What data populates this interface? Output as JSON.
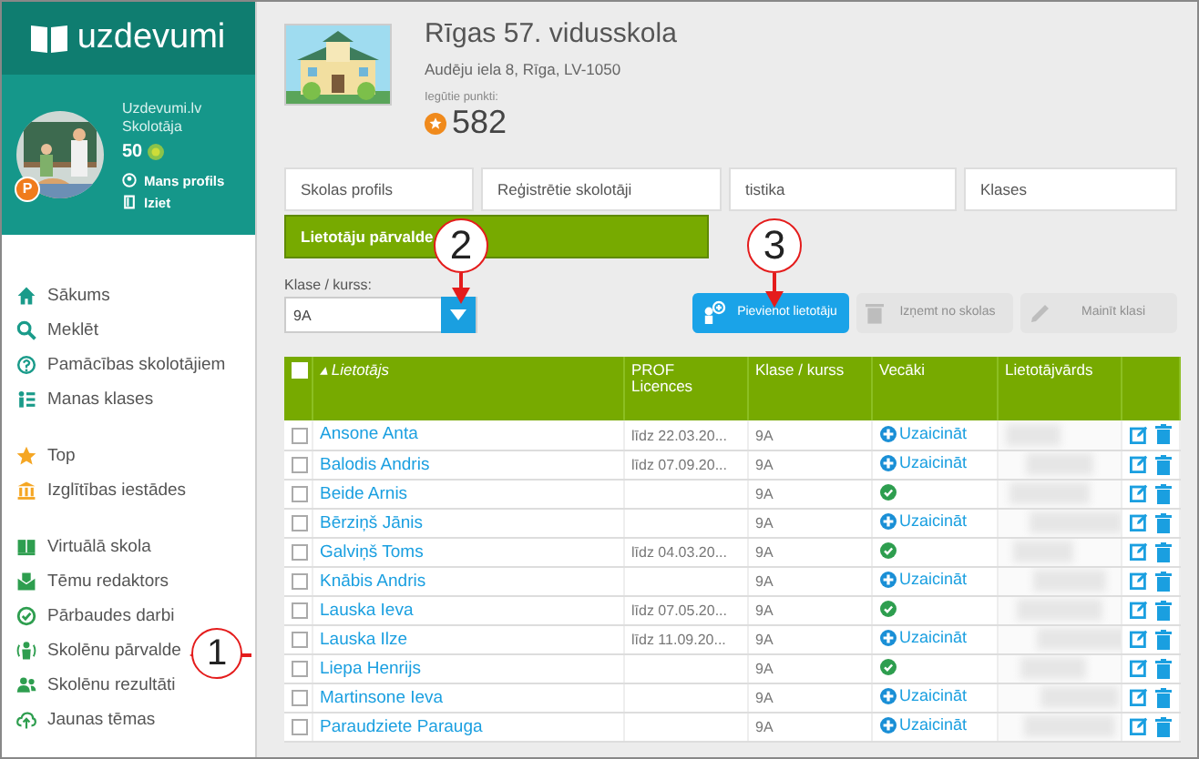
{
  "sidebar": {
    "logo": "uzdevumi",
    "profile": {
      "name": "Uzdevumi.lv",
      "role": "Skolotāja",
      "badge": "P",
      "points": "50",
      "links": [
        "Mans profils",
        "Iziet"
      ]
    },
    "nav_groups": [
      {
        "items": [
          {
            "label": "Sākums"
          },
          {
            "label": "Meklēt"
          },
          {
            "label": "Pamācības skolotājiem"
          },
          {
            "label": "Manas klases"
          }
        ]
      },
      {
        "items": [
          {
            "label": "Top"
          },
          {
            "label": "Izglītības iestādes"
          }
        ]
      },
      {
        "items": [
          {
            "label": "Virtuālā skola"
          },
          {
            "label": "Tēmu redaktors"
          },
          {
            "label": "Pārbaudes darbi"
          },
          {
            "label": "Skolēnu pārvalde"
          },
          {
            "label": "Skolēnu rezultāti"
          },
          {
            "label": "Jaunas tēmas"
          }
        ]
      }
    ]
  },
  "school": {
    "name": "Rīgas 57. vidusskola",
    "address": "Audēju iela 8, Rīga, LV-1050",
    "points_label": "Iegūtie punkti:",
    "points": "582"
  },
  "tabs": [
    {
      "label": "Skolas profils",
      "selected": false
    },
    {
      "label": "Reģistrētie skolotāji",
      "selected": false
    },
    {
      "label": "tistika",
      "selected": false
    },
    {
      "label": "Klases",
      "selected": false
    },
    {
      "label": "Lietotāju pārvalde",
      "selected": true
    }
  ],
  "filter": {
    "label": "Klase / kurss:",
    "value": "9A"
  },
  "buttons": [
    {
      "label": "Pievienot lietotāju",
      "disabled": false
    },
    {
      "label": "Izņemt no skolas",
      "disabled": true
    },
    {
      "label": "Mainīt klasi",
      "disabled": true
    }
  ],
  "table": {
    "select_all": false,
    "sort_mark": "▴",
    "columns": [
      "Lietotājs",
      "PROF Licences",
      "Klase / kurss",
      "Vecāki",
      "Lietotājvārds"
    ],
    "rows": [
      {
        "checked": false,
        "name": "Ansone Anta",
        "licence": "līdz 22.03.20...",
        "class": "9A",
        "parents": {
          "kind": "invite",
          "label": "Uzaicināt"
        }
      },
      {
        "checked": false,
        "name": "Balodis Andris",
        "licence": "līdz 07.09.20...",
        "class": "9A",
        "parents": {
          "kind": "invite",
          "label": "Uzaicināt"
        }
      },
      {
        "checked": false,
        "name": "Beide Arnis",
        "class": "9A",
        "parents": {
          "kind": "confirmed"
        }
      },
      {
        "checked": false,
        "name": "Bērziņš Jānis",
        "class": "9A",
        "parents": {
          "kind": "invite",
          "label": "Uzaicināt"
        }
      },
      {
        "checked": false,
        "name": "Galviņš Toms",
        "licence": "līdz 04.03.20...",
        "class": "9A",
        "parents": {
          "kind": "confirmed"
        }
      },
      {
        "checked": false,
        "name": "Knābis Andris",
        "class": "9A",
        "parents": {
          "kind": "invite",
          "label": "Uzaicināt"
        }
      },
      {
        "checked": false,
        "name": "Lauska Ieva",
        "licence": "līdz 07.05.20...",
        "class": "9A",
        "parents": {
          "kind": "confirmed"
        }
      },
      {
        "checked": false,
        "name": "Lauska Ilze",
        "licence": "līdz 11.09.20...",
        "class": "9A",
        "parents": {
          "kind": "invite",
          "label": "Uzaicināt"
        }
      },
      {
        "checked": false,
        "name": "Liepa Henrijs",
        "class": "9A",
        "parents": {
          "kind": "confirmed"
        }
      },
      {
        "checked": false,
        "name": "Martinsone Ieva",
        "class": "9A",
        "parents": {
          "kind": "invite",
          "label": "Uzaicināt"
        }
      },
      {
        "checked": false,
        "name": "Paraudziete Parauga",
        "class": "9A",
        "parents": {
          "kind": "invite",
          "label": "Uzaicināt"
        }
      }
    ]
  },
  "annotations": [
    {
      "label": "1"
    },
    {
      "label": "2"
    },
    {
      "label": "3"
    }
  ]
}
